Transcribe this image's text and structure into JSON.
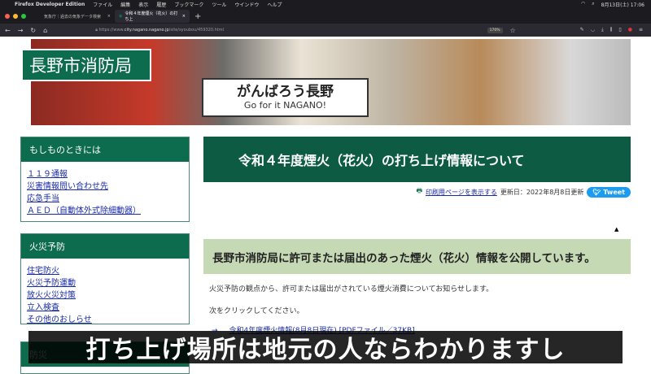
{
  "menubar": {
    "app": "Firefox Developer Edition",
    "items": [
      "ファイル",
      "編集",
      "表示",
      "履歴",
      "ブックマーク",
      "ツール",
      "ウインドウ",
      "ヘルプ"
    ],
    "datetime": "8月13日(土) 17:06"
  },
  "tabs": [
    {
      "label": "気象庁｜過去の気象データ検索"
    },
    {
      "label": "令和４年度煙火（花火）の打ち上"
    }
  ],
  "url": {
    "prefix": "https://www.",
    "domain": "city.nagano.nagano.jp",
    "path": "/site/syoubou/459320.html",
    "zoom": "170%"
  },
  "site": {
    "logo": "長野市消防局",
    "banner_sign": "がんばろう長野",
    "banner_sign_en": "Go for it NAGANO!"
  },
  "sidebar": [
    {
      "title": "もしものときには",
      "items": [
        "１１９通報",
        "災害情報問い合わせ先",
        "応急手当",
        "ＡＥＤ（自動体外式除細動器）"
      ]
    },
    {
      "title": "火災予防",
      "items": [
        "住宅防火",
        "火災予防運動",
        "放火火災対策",
        "立入検査",
        "その他のおしらせ"
      ]
    },
    {
      "title": "防災",
      "items": []
    }
  ],
  "main": {
    "title": "令和４年度煙火（花火）の打ち上げ情報について",
    "print_link": "印刷用ページを表示する",
    "updated": "更新日：2022年8月8日更新",
    "tweet": "Tweet",
    "note": "長野市消防局に許可または届出のあった煙火（花火）情報を公開しています。",
    "para1": "火災予防の観点から、許可または届出がされている煙火消費についてお知らせします。",
    "para2": "次をクリックしてください。",
    "file_link": "令和4年度煙火情報(8月8日現在) [PDFファイル／37KB]"
  },
  "subtitle": "打ち上げ場所は地元の人ならわかりますし"
}
